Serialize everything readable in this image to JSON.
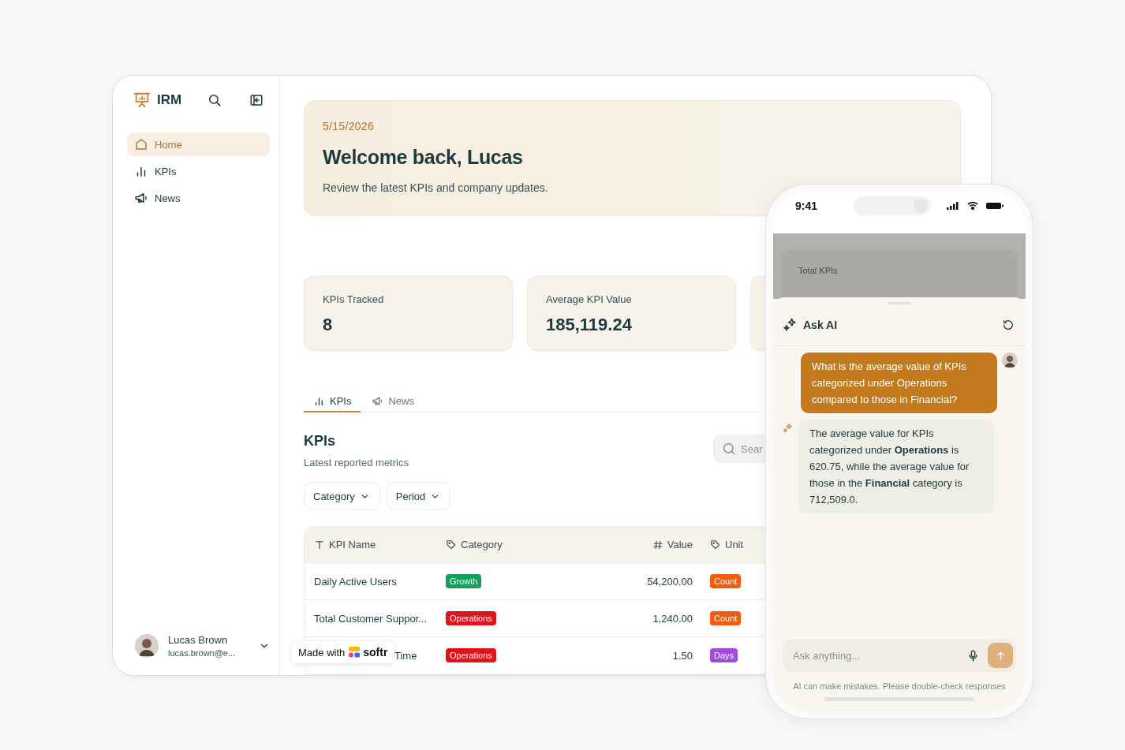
{
  "sidebar": {
    "brand": "IRM",
    "items": [
      {
        "label": "Home",
        "selected": true
      },
      {
        "label": "KPIs",
        "selected": false
      },
      {
        "label": "News",
        "selected": false
      }
    ],
    "user": {
      "name": "Lucas Brown",
      "email": "lucas.brown@e..."
    }
  },
  "hero": {
    "date": "5/15/2026",
    "title": "Welcome back, Lucas",
    "subtitle": "Review the latest KPIs and company updates."
  },
  "stats": [
    {
      "label": "KPIs Tracked",
      "value": "8"
    },
    {
      "label": "Average KPI Value",
      "value": "185,119.24"
    }
  ],
  "tabs": [
    {
      "label": "KPIs",
      "selected": true
    },
    {
      "label": "News",
      "selected": false
    }
  ],
  "section": {
    "title": "KPIs",
    "subtitle": "Latest reported metrics",
    "search_placeholder": "Sear"
  },
  "filters": [
    "Category",
    "Period"
  ],
  "table": {
    "columns": [
      "KPI Name",
      "Category",
      "Value",
      "Unit"
    ],
    "rows": [
      {
        "name": "Daily Active Users",
        "category": {
          "label": "Growth",
          "color": "#14a05a"
        },
        "value": "54,200.00",
        "unit": {
          "label": "Count",
          "color": "#f25c0c"
        }
      },
      {
        "name": "Total Customer Suppor...",
        "category": {
          "label": "Operations",
          "color": "#e0121c"
        },
        "value": "1,240.00",
        "unit": {
          "label": "Count",
          "color": "#f25c0c"
        }
      },
      {
        "name": "Time",
        "category": {
          "label": "Operations",
          "color": "#e0121c"
        },
        "value": "1.50",
        "unit": {
          "label": "Days",
          "color": "#a04ce0"
        }
      }
    ]
  },
  "badge": {
    "prefix": "Made with",
    "brand": "softr"
  },
  "phone": {
    "time": "9:41",
    "background_card": {
      "label": "Total KPIs"
    },
    "chat": {
      "title": "Ask AI",
      "messages": [
        {
          "kind": "user",
          "text": "What is the average value of KPIs categorized under Operations compared to those in Financial?"
        },
        {
          "kind": "assistant",
          "text": "The average value for KPIs categorized under **Operations** is 620.75, while the average value for those in the **Financial** category is 712,509.0."
        }
      ],
      "placeholder": "Ask anything...",
      "disclaimer": "AI can make mistakes. Please double-check responses"
    }
  }
}
